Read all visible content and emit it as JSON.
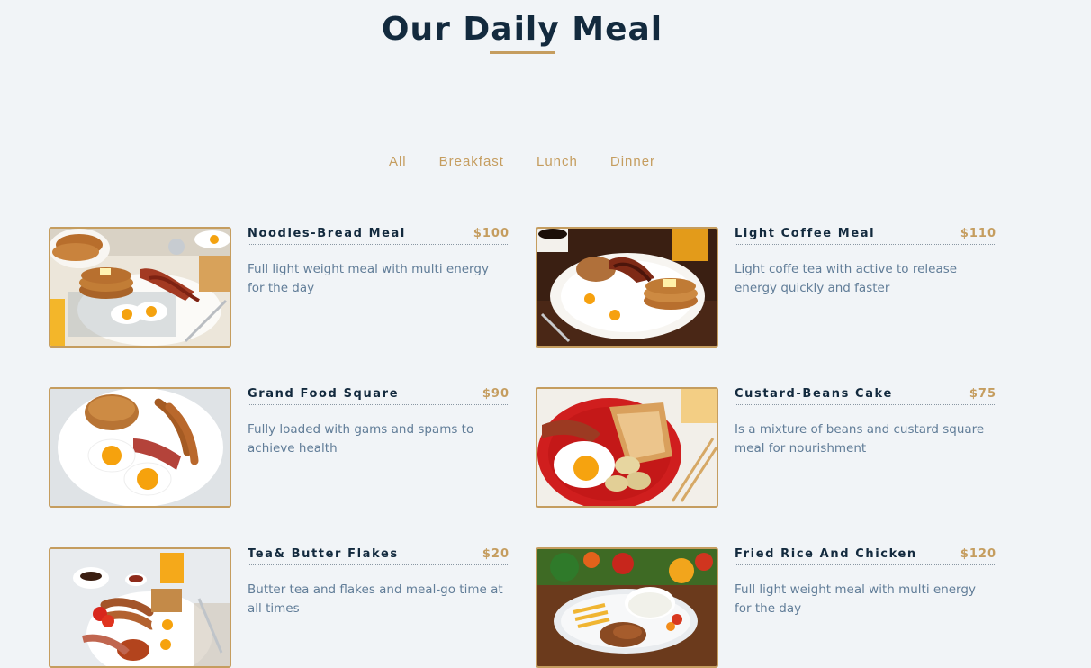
{
  "page": {
    "title": "Our Daily Meal"
  },
  "filters": [
    "All",
    "Breakfast",
    "Lunch",
    "Dinner"
  ],
  "menu_items": [
    {
      "title": "Noodles-Bread Meal",
      "price": "$100",
      "description": "Full light weight meal with multi energy for the day",
      "photo_icon": "pancakes-eggs-bacon-photo"
    },
    {
      "title": "Light Coffee Meal",
      "price": "$110",
      "description": "Light coffe tea with active to release energy quickly and faster",
      "photo_icon": "coffee-pancakes-photo"
    },
    {
      "title": "Grand Food Square",
      "price": "$90",
      "description": "Fully loaded with gams and spams to achieve health",
      "photo_icon": "eggs-sausage-pancake-photo"
    },
    {
      "title": "Custard-Beans Cake",
      "price": "$75",
      "description": "Is a mixture of beans and custard square meal for nourishment",
      "photo_icon": "toast-egg-potato-photo"
    },
    {
      "title": "Tea& Butter Flakes",
      "price": "$20",
      "description": "Butter tea and flakes and meal-go time at all times",
      "photo_icon": "full-breakfast-photo"
    },
    {
      "title": "Fried Rice And Chicken",
      "price": "$120",
      "description": "Full light weight meal with multi energy for the day",
      "photo_icon": "rice-chicken-photo"
    }
  ],
  "colors": {
    "background": "#f1f4f7",
    "accent": "#c59d5f",
    "heading": "#132a3e",
    "text": "#617d98"
  }
}
